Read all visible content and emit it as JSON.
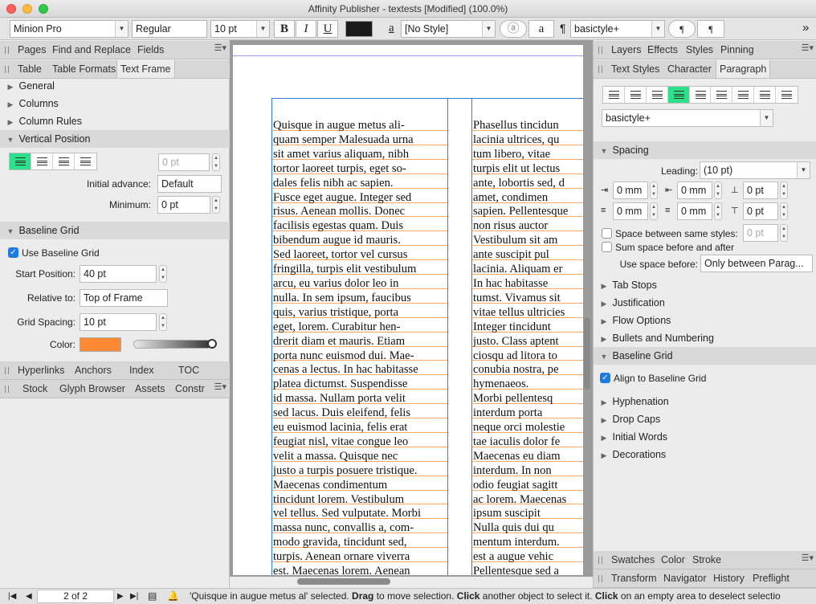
{
  "window": {
    "title": "Affinity Publisher - textests [Modified] (100.0%)"
  },
  "toolbar": {
    "font": "Minion Pro",
    "style": "Regular",
    "size": "10 pt",
    "bold": "B",
    "italic": "I",
    "underline": "U",
    "char_style": "[No Style]",
    "a1": "ⓐ",
    "a2": "a",
    "para_glyph": "¶",
    "para_style": "basictyle+",
    "more": "»"
  },
  "left": {
    "tabs1": [
      "Pages",
      "Find and Replace",
      "Fields"
    ],
    "tabs2": [
      "Table",
      "Table Formats",
      "Text Frame"
    ],
    "sections": [
      "General",
      "Columns",
      "Column Rules",
      "Vertical Position"
    ],
    "vp": {
      "offset": "0 pt",
      "initial_label": "Initial advance:",
      "initial": "Default",
      "min_label": "Minimum:",
      "min": "0 pt"
    },
    "baseline": {
      "title": "Baseline Grid",
      "use": "Use Baseline Grid",
      "start_label": "Start Position:",
      "start": "40 pt",
      "rel_label": "Relative to:",
      "rel": "Top of Frame",
      "spacing_label": "Grid Spacing:",
      "spacing": "10 pt",
      "color_label": "Color:",
      "color": "#ff8a33"
    },
    "tabs3": [
      "Hyperlinks",
      "Anchors",
      "Index",
      "TOC"
    ],
    "tabs4": [
      "Stock",
      "Glyph Browser",
      "Assets",
      "Constr"
    ]
  },
  "right": {
    "tabs1": [
      "Layers",
      "Effects",
      "Styles",
      "Pinning"
    ],
    "tabs2": [
      "Text Styles",
      "Character",
      "Paragraph"
    ],
    "para_style": "basictyle+",
    "spacing": {
      "title": "Spacing",
      "leading_label": "Leading:",
      "leading": "(10 pt)",
      "v1": "0 mm",
      "v2": "0 mm",
      "v3": "0 pt",
      "v4": "0 mm",
      "v5": "0 mm",
      "v6": "0 pt",
      "same_label": "Space between same styles:",
      "same": "0 pt",
      "sum": "Sum space before and after",
      "use_label": "Use space before:",
      "use": "Only between Parag..."
    },
    "sections": [
      "Tab Stops",
      "Justification",
      "Flow Options",
      "Bullets and Numbering"
    ],
    "baseline_title": "Baseline Grid",
    "align": "Align to Baseline Grid",
    "sections2": [
      "Hyphenation",
      "Drop Caps",
      "Initial Words",
      "Decorations"
    ],
    "tabs3": [
      "Swatches",
      "Color",
      "Stroke"
    ],
    "tabs4": [
      "Transform",
      "Navigator",
      "History",
      "Preflight"
    ]
  },
  "doc": {
    "col1": [
      "Quisque in augue metus ali-",
      "quam semper Malesuada urna",
      "sit amet varius aliquam, nibh",
      "tortor laoreet turpis, eget so-",
      "dales felis nibh ac sapien.",
      "Fusce eget augue. Integer sed",
      "risus. Aenean mollis. Donec",
      "facilisis egestas quam. Duis",
      "bibendum augue id mauris.",
      "Sed laoreet, tortor vel cursus",
      "fringilla, turpis elit vestibulum",
      "arcu, eu varius dolor leo in",
      "nulla. In sem ipsum, faucibus",
      "quis, varius tristique, porta",
      "eget, lorem. Curabitur hen-",
      "drerit diam et mauris. Etiam",
      "porta nunc euismod dui. Mae-",
      "cenas a lectus. In hac habitasse",
      "platea dictumst. Suspendisse",
      "id massa. Nullam porta velit",
      "sed lacus. Duis eleifend, felis",
      "eu euismod lacinia, felis erat",
      "feugiat nisl, vitae congue leo",
      "velit a massa. Quisque nec",
      "justo a turpis posuere tristique.",
      "Maecenas condimentum",
      "tincidunt lorem. Vestibulum",
      "vel tellus. Sed vulputate. Morbi",
      "massa nunc, convallis a, com-",
      "modo gravida, tincidunt sed,",
      "turpis. Aenean ornare viverra",
      "est. Maecenas lorem. Aenean"
    ],
    "col2": [
      "Phasellus tincidun",
      "lacinia ultrices, qu",
      "tum libero, vitae",
      "turpis elit ut lectus",
      "ante, lobortis sed, d",
      "amet, condimen",
      "sapien. Pellentesque",
      "non risus auctor",
      "Vestibulum sit am",
      "ante suscipit pul",
      "lacinia. Aliquam er",
      "In hac habitasse",
      "tumst. Vivamus sit",
      "vitae tellus ultricies",
      "Integer tincidunt",
      "justo. Class aptent",
      "ciosqu ad litora to",
      "conubia nostra, pe",
      "hymenaeos.",
      "Morbi pellentesq",
      "interdum porta",
      "neque orci molestie",
      "tae iaculis dolor fe",
      "Maecenas eu diam",
      "interdum. In non",
      "odio feugiat sagitt",
      "ac lorem. Maecenas",
      "ipsum suscipit",
      "Nulla quis dui qu",
      "mentum interdum.",
      "est a augue vehic",
      "Pellentesque sed a"
    ]
  },
  "status": {
    "page": "2 of 2",
    "msg_a": "'Quisque in augue metus al' selected. ",
    "drag": "Drag",
    "msg_b": " to move selection. ",
    "click": "Click",
    "msg_c": " another object to select it. ",
    "click2": "Click",
    "msg_d": " on an empty area to deselect selectio"
  }
}
